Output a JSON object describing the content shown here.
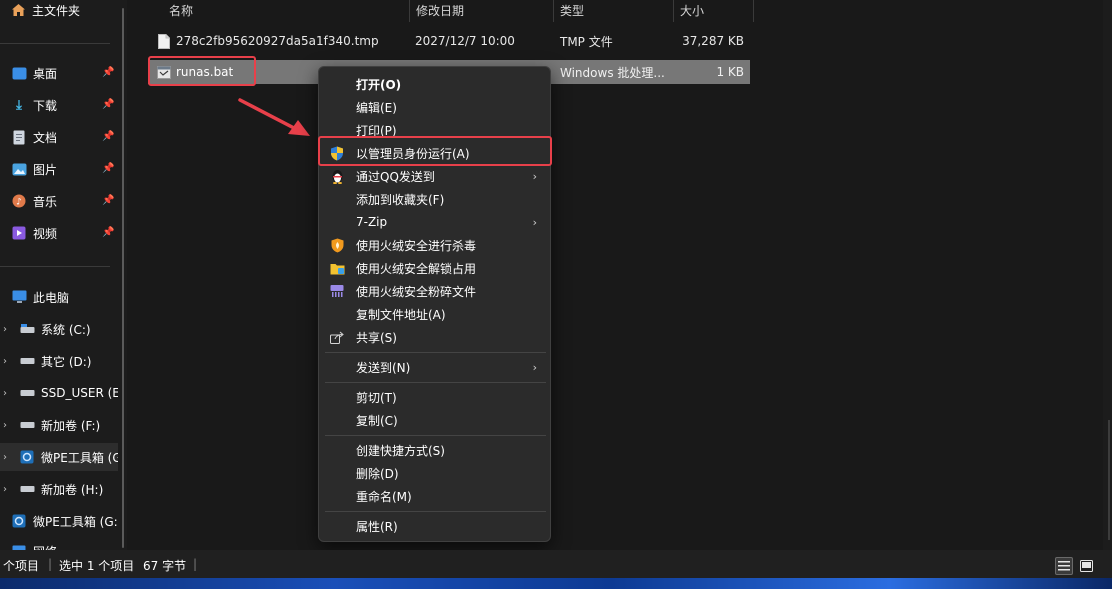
{
  "sidebar": {
    "home": {
      "label": "主文件夹",
      "icon": "home-icon"
    },
    "quick": [
      {
        "label": "桌面",
        "icon": "desktop-icon",
        "color": "#3a8ee6"
      },
      {
        "label": "下载",
        "icon": "download-icon",
        "color": "#45b9e8"
      },
      {
        "label": "文档",
        "icon": "document-icon",
        "color": "#cfd6df"
      },
      {
        "label": "图片",
        "icon": "pictures-icon",
        "color": "#4aa3e0"
      },
      {
        "label": "音乐",
        "icon": "music-icon",
        "color": "#e07a4a"
      },
      {
        "label": "视频",
        "icon": "video-icon",
        "color": "#8a5ae0"
      }
    ],
    "this_pc": {
      "label": "此电脑",
      "icon": "computer-icon"
    },
    "drives": [
      {
        "label": "系统 (C:)",
        "icon": "drive-c-icon"
      },
      {
        "label": "其它 (D:)",
        "icon": "drive-icon"
      },
      {
        "label": "SSD_USER (E:",
        "icon": "drive-icon"
      },
      {
        "label": "新加卷 (F:)",
        "icon": "drive-icon"
      },
      {
        "label": "微PE工具箱 (G",
        "icon": "disc-icon"
      },
      {
        "label": "新加卷 (H:)",
        "icon": "drive-icon"
      },
      {
        "label": "微PE工具箱 (G:)",
        "icon": "disc-icon"
      },
      {
        "label": "网络",
        "icon": "network-icon"
      }
    ]
  },
  "columns": {
    "name": "名称",
    "date": "修改日期",
    "type": "类型",
    "size": "大小"
  },
  "files": [
    {
      "name": "278c2fb95620927da5a1f340.tmp",
      "date": "2027/12/7 10:00",
      "type": "TMP 文件",
      "size": "37,287 KB",
      "icon": "file-icon"
    },
    {
      "name": "runas.bat",
      "date": "",
      "type": "Windows 批处理...",
      "size": "1 KB",
      "icon": "batch-file-icon"
    }
  ],
  "context_menu": {
    "open": "打开(O)",
    "edit": "编辑(E)",
    "print": "打印(P)",
    "run_as_admin": "以管理员身份运行(A)",
    "send_qq": "通过QQ发送到",
    "add_favorites": "添加到收藏夹(F)",
    "seven_zip": "7-Zip",
    "huorong_scan": "使用火绒安全进行杀毒",
    "huorong_unlock": "使用火绒安全解锁占用",
    "huorong_shred": "使用火绒安全粉碎文件",
    "copy_path": "复制文件地址(A)",
    "share": "共享(S)",
    "send_to": "发送到(N)",
    "cut": "剪切(T)",
    "copy": "复制(C)",
    "create_shortcut": "创建快捷方式(S)",
    "delete": "删除(D)",
    "rename": "重命名(M)",
    "properties": "属性(R)"
  },
  "status": {
    "count": "个项目",
    "selected": "选中 1 个项目",
    "bytes": "67 字节"
  },
  "colors": {
    "highlight": "#e8404a",
    "accent": "#4aa3e0"
  }
}
